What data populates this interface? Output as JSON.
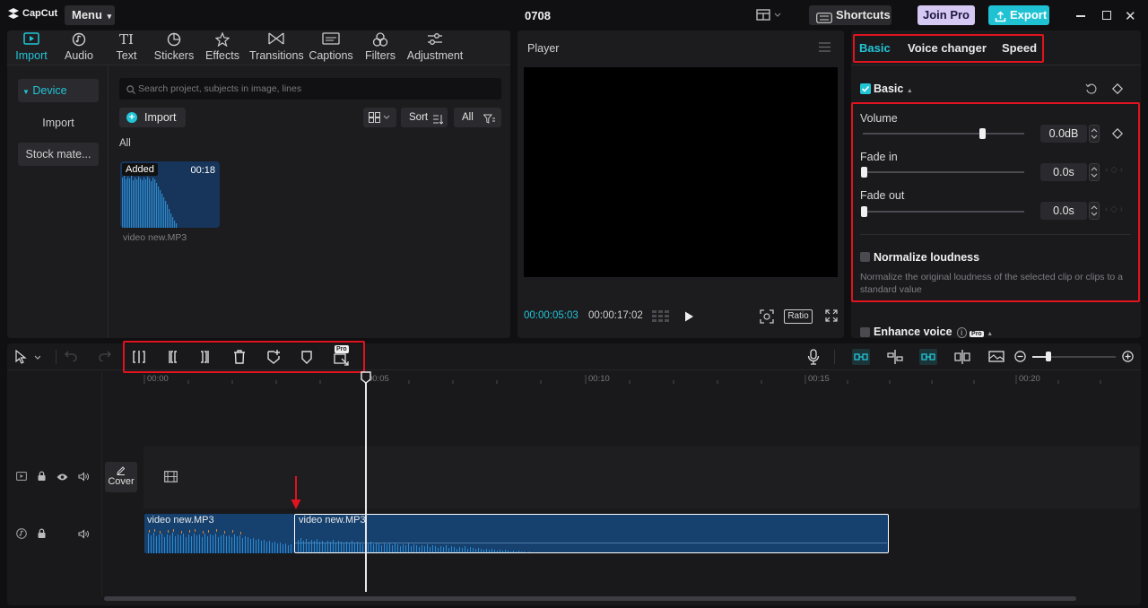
{
  "topbar": {
    "logo": "CapCut",
    "menu": "Menu",
    "project_title": "0708",
    "shortcuts": "Shortcuts",
    "join_pro": "Join Pro",
    "export": "Export"
  },
  "media_tabs": [
    {
      "label": "Import",
      "icon": "import-icon",
      "active": true
    },
    {
      "label": "Audio",
      "icon": "audio-icon"
    },
    {
      "label": "Text",
      "icon": "text-icon"
    },
    {
      "label": "Stickers",
      "icon": "stickers-icon"
    },
    {
      "label": "Effects",
      "icon": "effects-icon"
    },
    {
      "label": "Transitions",
      "icon": "transitions-icon"
    },
    {
      "label": "Captions",
      "icon": "captions-icon"
    },
    {
      "label": "Filters",
      "icon": "filters-icon"
    },
    {
      "label": "Adjustment",
      "icon": "adjustment-icon"
    }
  ],
  "left_nav": {
    "device": "Device",
    "import": "Import",
    "stock": "Stock mate..."
  },
  "media": {
    "search_placeholder": "Search project, subjects in image, lines",
    "import_button": "Import",
    "sort": "Sort",
    "filter_all": "All",
    "section_all": "All",
    "clip": {
      "badge": "Added",
      "duration": "00:18",
      "name": "video new.MP3"
    }
  },
  "player": {
    "title": "Player",
    "current_time": "00:00:05:03",
    "total_time": "00:00:17:02",
    "ratio": "Ratio"
  },
  "inspector": {
    "tabs": [
      "Basic",
      "Voice changer",
      "Speed"
    ],
    "section": "Basic",
    "volume_label": "Volume",
    "volume_value": "0.0dB",
    "volume_level": 0.74,
    "fade_in_label": "Fade in",
    "fade_in_value": "0.0s",
    "fade_out_label": "Fade out",
    "fade_out_value": "0.0s",
    "normalize_label": "Normalize loudness",
    "normalize_desc": "Normalize the original loudness of the selected clip or clips to a standard value",
    "enhance_label": "Enhance voice"
  },
  "timeline": {
    "ruler": [
      "00:00",
      "00:05",
      "00:10",
      "00:15",
      "00:20"
    ],
    "cover_label": "Cover",
    "clip1_name": "video new.MP3",
    "clip2_name": "video new.MP3",
    "pro_badge": "Pro"
  },
  "colors": {
    "accent": "#22c5d6",
    "highlight": "#e0131f",
    "clip_blue": "#16406e",
    "join_pro": "#c9b9f0"
  }
}
